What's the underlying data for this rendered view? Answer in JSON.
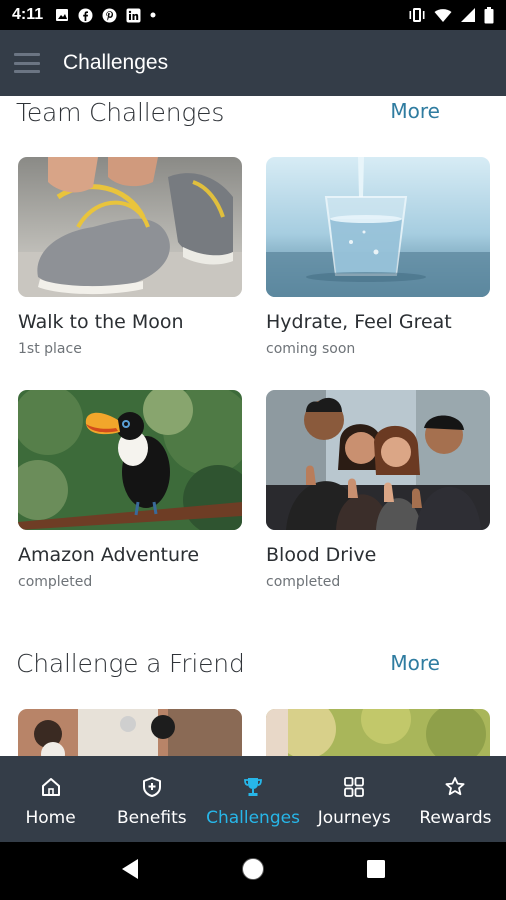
{
  "status_bar": {
    "time": "4:11",
    "left_icons": [
      "photo-icon",
      "facebook-icon",
      "pinterest-icon",
      "linkedin-icon",
      "dot-icon"
    ],
    "right_icons": [
      "vibrate-icon",
      "wifi-icon",
      "signal-icon",
      "battery-icon"
    ]
  },
  "app_bar": {
    "title": "Challenges"
  },
  "team_section": {
    "title": "Team Challenges",
    "more": "More",
    "cards": [
      {
        "title": "Walk to the Moon",
        "subtitle": "1st place",
        "image": "running-shoes-photo"
      },
      {
        "title": "Hydrate, Feel Great",
        "subtitle": "coming soon",
        "image": "water-glass-photo"
      },
      {
        "title": "Amazon Adventure",
        "subtitle": "completed",
        "image": "toucan-photo"
      },
      {
        "title": "Blood Drive",
        "subtitle": "completed",
        "image": "group-thumbs-up-photo"
      }
    ]
  },
  "friend_section": {
    "title": "Challenge a Friend",
    "more": "More",
    "cards": [
      {
        "image": "office-people-photo"
      },
      {
        "image": "outdoor-greenery-photo"
      }
    ]
  },
  "bottom_nav": {
    "items": [
      {
        "label": "Home",
        "icon": "home-icon",
        "active": false
      },
      {
        "label": "Benefits",
        "icon": "shield-plus-icon",
        "active": false
      },
      {
        "label": "Challenges",
        "icon": "trophy-icon",
        "active": true
      },
      {
        "label": "Journeys",
        "icon": "grid-icon",
        "active": false
      },
      {
        "label": "Rewards",
        "icon": "star-icon",
        "active": false
      }
    ]
  },
  "colors": {
    "app_bar": "#343d48",
    "accent": "#27b6e8",
    "more_link": "#2f7ca0"
  }
}
